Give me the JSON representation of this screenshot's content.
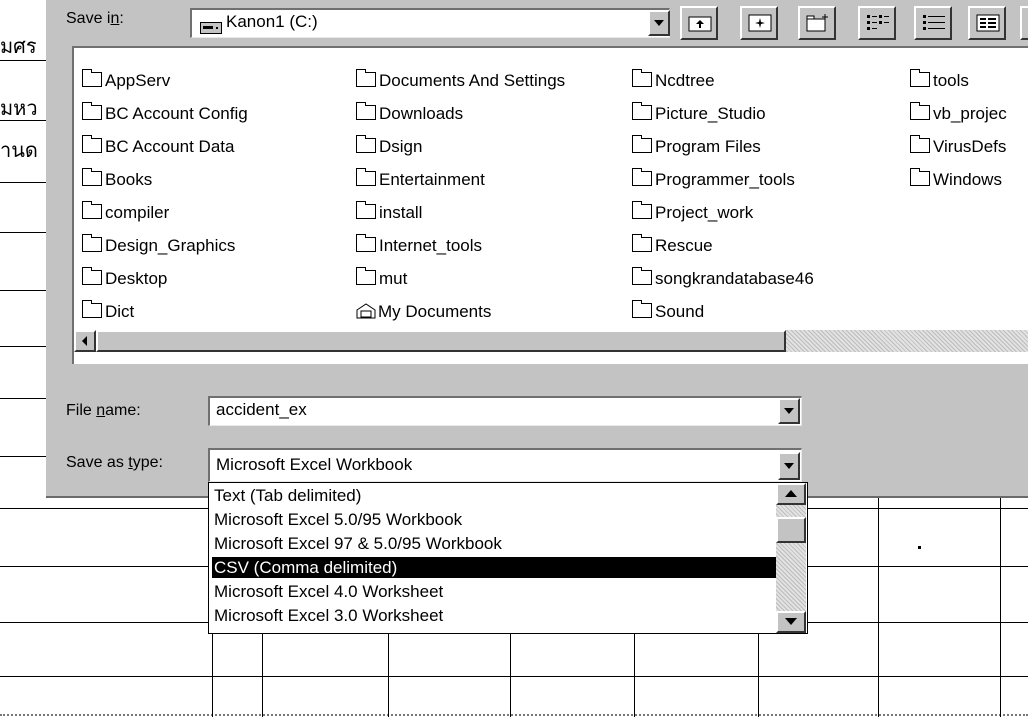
{
  "sheet": {
    "row1": "มศร",
    "row2": "มหว",
    "row3": "านด"
  },
  "dialog": {
    "save_in_label": "Save in:",
    "location": "Kanon1 (C:)",
    "file_name_label": "File name:",
    "file_name_value": "accident_ex",
    "save_as_type_label": "Save as type:",
    "save_as_type_value": "Microsoft Excel Workbook"
  },
  "files": {
    "col1": [
      "AppServ",
      "BC Account Config",
      "BC Account Data",
      "Books",
      "compiler",
      "Design_Graphics",
      "Desktop",
      "Dict"
    ],
    "col2": [
      "Documents And Settings",
      "Downloads",
      "Dsign",
      "Entertainment",
      "install",
      "Internet_tools",
      "mut",
      "My Documents"
    ],
    "col3": [
      "Ncdtree",
      "Picture_Studio",
      "Program Files",
      "Programmer_tools",
      "Project_work",
      "Rescue",
      "songkrandatabase46",
      "Sound"
    ],
    "col4": [
      "tools",
      "vb_projec",
      "VirusDefs",
      "Windows"
    ]
  },
  "type_options": [
    "Text (Tab delimited)",
    "Microsoft Excel 5.0/95 Workbook",
    "Microsoft Excel 97 & 5.0/95 Workbook",
    "CSV (Comma delimited)",
    "Microsoft Excel 4.0 Worksheet",
    "Microsoft Excel 3.0 Worksheet"
  ],
  "selected_type_index": 3,
  "icons": {
    "folder": "folder-icon",
    "drive": "hard-drive-icon",
    "my_documents": "my-documents-icon",
    "up_folder": "up-one-level-icon",
    "search_web": "search-web-icon",
    "new_folder": "create-new-folder-icon",
    "list_view": "list-view-icon",
    "details_view": "details-view-icon",
    "properties": "properties-icon",
    "tools": "tools-icon"
  }
}
